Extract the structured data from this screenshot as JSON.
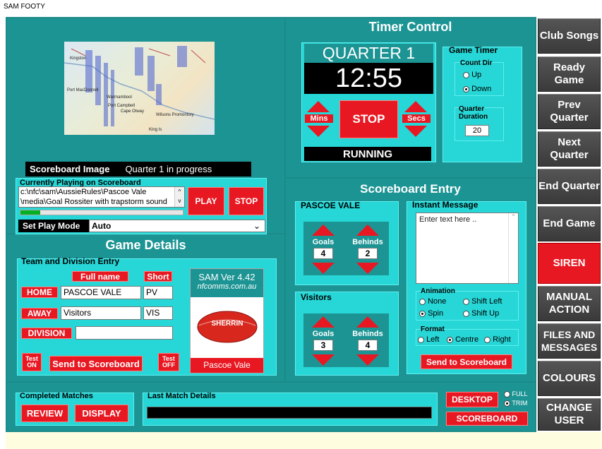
{
  "app_title": "SAM FOOTY",
  "scoreboard_image": {
    "label": "Scoreboard Image",
    "status": "Quarter 1 in progress",
    "map_labels": [
      "Cape Otway",
      "Port Campbell",
      "Port MacDonnell",
      "Warrnambool",
      "Portland",
      "Kingston",
      "Wilsons Promontory",
      "King Is"
    ]
  },
  "now_playing": {
    "legend": "Currently Playing on Scoreboard",
    "line1": "c:\\nfc\\sam\\AussieRules\\Pascoe Vale",
    "line2": "\\media\\Goal Rossiter with trapstorm sound",
    "progress": 0.12,
    "play": "PLAY",
    "stop": "STOP",
    "mode_label": "Set Play Mode",
    "mode_value": "Auto"
  },
  "timer": {
    "heading": "Timer Control",
    "quarter": "QUARTER 1",
    "time": "12:55",
    "mins": "Mins",
    "secs": "Secs",
    "stop": "STOP",
    "state": "RUNNING",
    "game_timer_legend": "Game Timer",
    "count_dir_legend": "Count Dir",
    "up": "Up",
    "down": "Down",
    "selected": "down",
    "duration_legend": "Quarter Duration",
    "duration": "20"
  },
  "game_details": {
    "heading": "Game Details",
    "entry_legend": "Team and Division Entry",
    "full_name": "Full name",
    "short": "Short",
    "home_label": "HOME",
    "home_full": "PASCOE VALE",
    "home_short": "PV",
    "away_label": "AWAY",
    "away_full": "Visitors",
    "away_short": "VIS",
    "division_label": "DIVISION",
    "division": "",
    "test_on": "Test ON",
    "test_off": "Test OFF",
    "send": "Send to Scoreboard",
    "version": "SAM  Ver 4.42",
    "site": "nfcomms.com.au",
    "ball_brand": "SHERRIN",
    "footer_team": "Pascoe Vale"
  },
  "scoreboard": {
    "heading": "Scoreboard  Entry",
    "home_team": "PASCOE VALE",
    "home_goals": "4",
    "home_behinds": "2",
    "away_team": "Visitors",
    "away_goals": "3",
    "away_behinds": "4",
    "goals": "Goals",
    "behinds": "Behinds"
  },
  "message": {
    "legend": "Instant Message",
    "placeholder": "Enter text here ..",
    "anim_legend": "Animation",
    "none": "None",
    "spin": "Spin",
    "shift_left": "Shift Left",
    "shift_up": "Shift Up",
    "anim_selected": "spin",
    "format_legend": "Format",
    "left": "Left",
    "centre": "Centre",
    "right": "Right",
    "format_selected": "centre",
    "send": "Send to Scoreboard"
  },
  "bottom": {
    "completed_legend": "Completed Matches",
    "review": "REVIEW",
    "display": "DISPLAY",
    "last_match_legend": "Last Match Details",
    "desktop": "DESKTOP",
    "scoreboard": "SCOREBOARD",
    "full": "FULL",
    "trim": "TRIM",
    "view_selected": "trim"
  },
  "side": {
    "club_songs": "Club Songs",
    "ready_game": "Ready Game",
    "prev_quarter": "Prev Quarter",
    "next_quarter": "Next Quarter",
    "end_quarter": "End Quarter",
    "end_game": "End Game",
    "siren": "SIREN",
    "manual_action": "MANUAL ACTION",
    "files_messages": "FILES AND MESSAGES",
    "colours": "COLOURS",
    "change_user": "CHANGE USER"
  },
  "colors": {
    "teal": "#1d9494",
    "cyan": "#27d6d6",
    "red": "#e81822",
    "panel_bg": "#fffde0"
  }
}
